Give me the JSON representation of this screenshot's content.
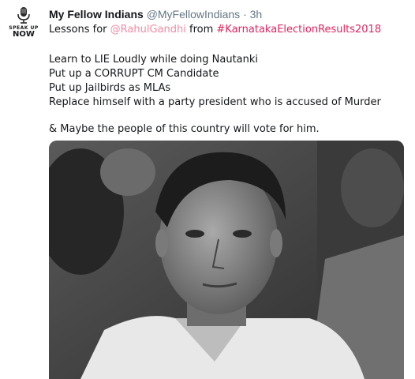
{
  "tweet": {
    "avatar": {
      "line1": "SPEAK UP",
      "line2": "NOW"
    },
    "author": {
      "name": "My Fellow Indians",
      "handle": "@MyFellowIndians",
      "separator": "·",
      "time": "3h"
    },
    "intro": {
      "prefix": "Lessons for ",
      "mention": "@RahulGandhi",
      "middle": " from ",
      "hashtag": "#KarnatakaElectionResults2018"
    },
    "lines": [
      "Learn to LIE Loudly while doing Nautanki",
      "Put up a CORRUPT CM Candidate",
      "Put up Jailbirds as MLAs",
      "Replace himself with a party president who is accused of Murder"
    ],
    "closing": "& Maybe the people of this country will vote for him."
  },
  "colors": {
    "mention": "#f08da6",
    "hashtag": "#e0245e",
    "muted": "#657786",
    "text": "#14171a"
  },
  "icons": [
    "microphone-icon"
  ]
}
